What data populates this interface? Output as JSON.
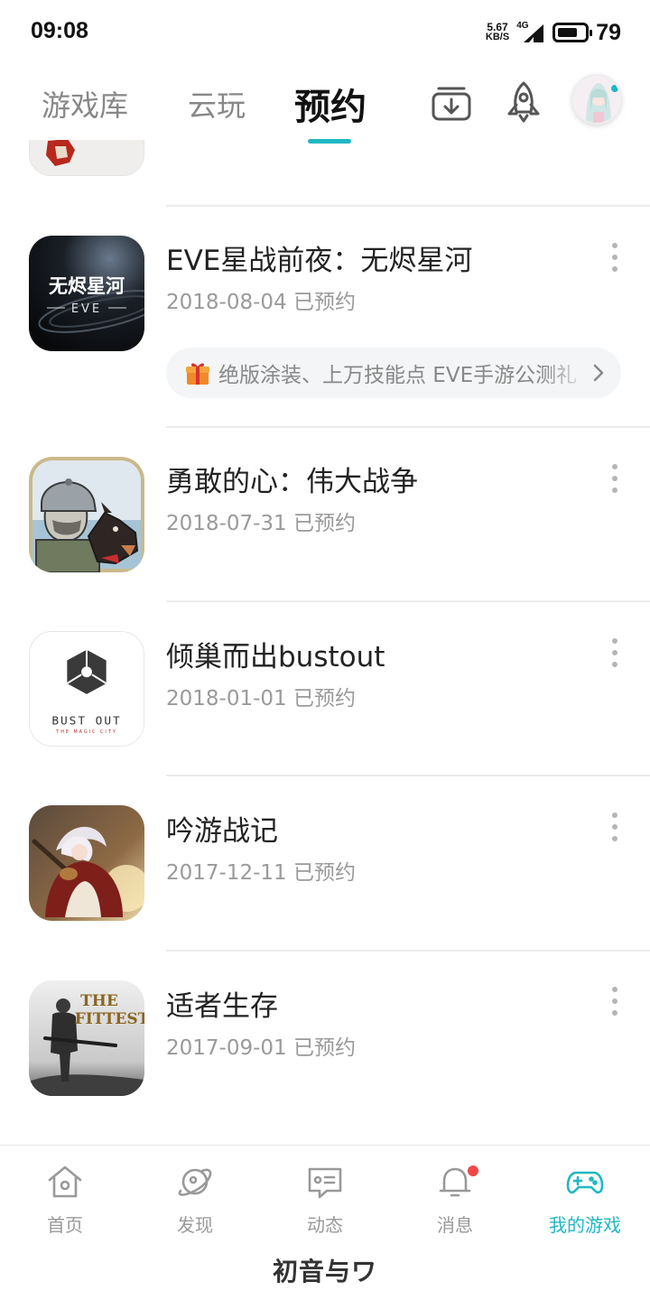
{
  "status_bar": {
    "time": "09:08",
    "net_speed_value": "5.67",
    "net_speed_unit": "KB/S",
    "network": "4G",
    "battery_level": "79",
    "battery_fraction": 0.79
  },
  "top_tabs": {
    "items": [
      {
        "label": "游戏库",
        "active": false
      },
      {
        "label": "云玩",
        "active": false
      },
      {
        "label": "预约",
        "active": true
      }
    ],
    "accent_color": "#1fb8c3",
    "download_icon": "download-tray-icon",
    "rocket_icon": "rocket-icon"
  },
  "reservations": [
    {
      "title": "EVE星战前夜：无烬星河",
      "date": "2018-08-04",
      "status": "已预约",
      "icon_text": "无烬星河",
      "icon_subtext": "EVE",
      "promo": "绝版涂装、上万技能点  EVE手游公测礼"
    },
    {
      "title": "勇敢的心：伟大战争",
      "date": "2018-07-31",
      "status": "已预约"
    },
    {
      "title": "倾巢而出bustout",
      "date": "2018-01-01",
      "status": "已预约",
      "icon_text": "BUST OUT",
      "icon_subtext": "THE MAGIC CITY"
    },
    {
      "title": "吟游战记",
      "date": "2017-12-11",
      "status": "已预约"
    },
    {
      "title": "适者生存",
      "date": "2017-09-01",
      "status": "已预约",
      "icon_text_1": "THE",
      "icon_text_2": "FITTEST"
    }
  ],
  "bottom_nav": {
    "items": [
      {
        "label": "首页",
        "icon": "home-icon"
      },
      {
        "label": "发现",
        "icon": "planet-icon"
      },
      {
        "label": "动态",
        "icon": "chat-card-icon"
      },
      {
        "label": "消息",
        "icon": "bell-icon",
        "has_badge": true
      },
      {
        "label": "我的游戏",
        "icon": "gamepad-icon",
        "active": true
      }
    ],
    "brand": "初音与ワ"
  }
}
